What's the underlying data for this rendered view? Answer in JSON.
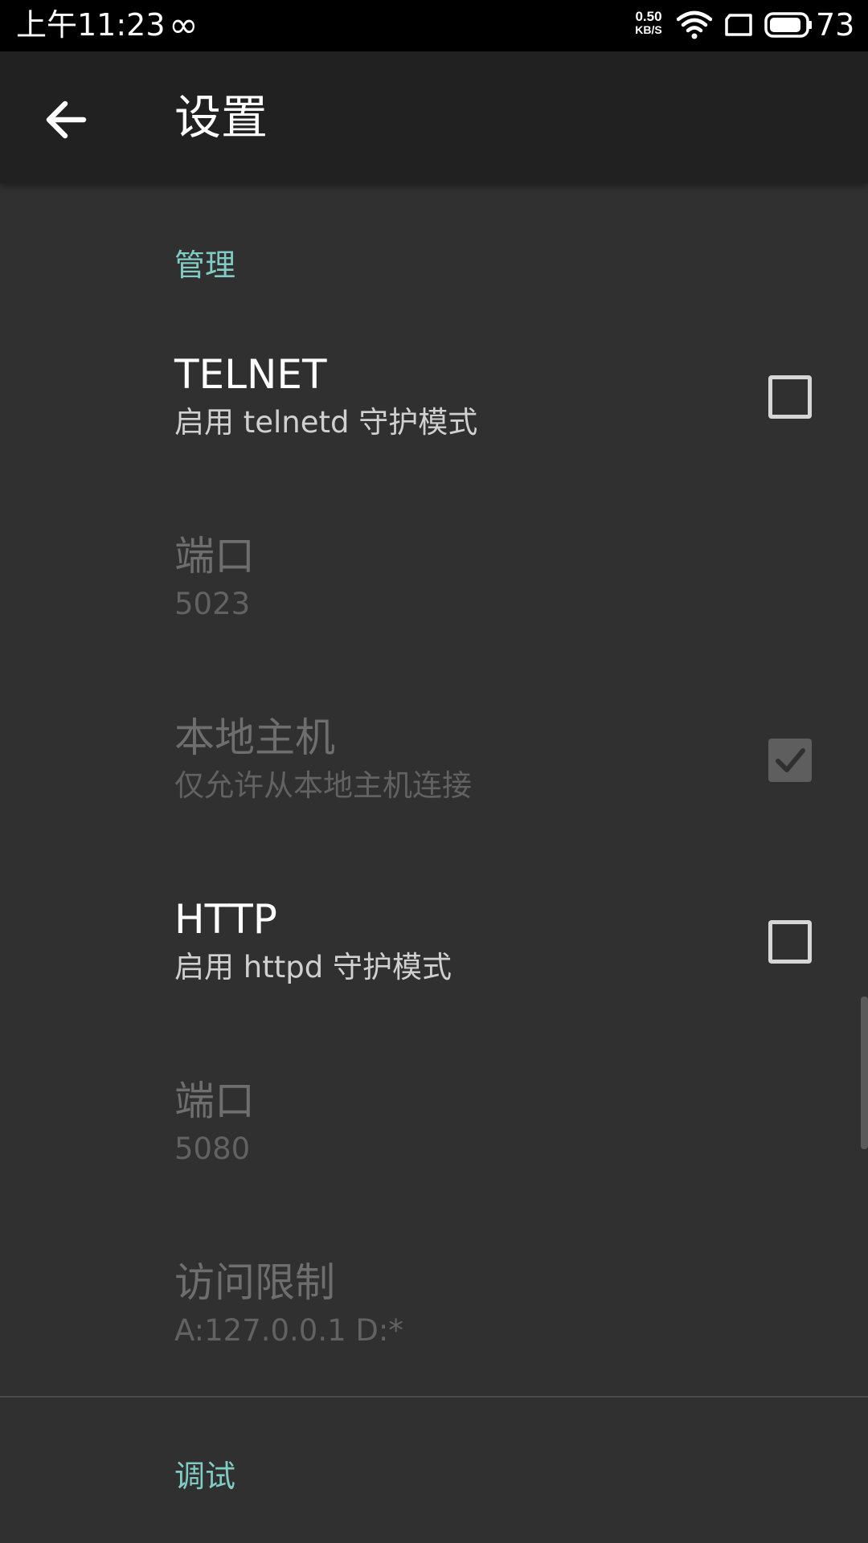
{
  "status_bar": {
    "time": "上午11:23",
    "infinity_icon": "∞",
    "net_speed_value": "0.50",
    "net_speed_unit": "KB/S",
    "battery_level": "73"
  },
  "app_bar": {
    "title": "设置",
    "back_icon": "arrow-back-icon"
  },
  "sections": {
    "management": {
      "header": "管理",
      "telnet": {
        "title": "TELNET",
        "summary": "启用 telnetd 守护模式",
        "checked": false,
        "enabled": true
      },
      "telnet_port": {
        "title": "端口",
        "summary": "5023",
        "enabled": false
      },
      "localhost": {
        "title": "本地主机",
        "summary": "仅允许从本地主机连接",
        "checked": true,
        "enabled": false
      },
      "http": {
        "title": "HTTP",
        "summary": "启用 httpd 守护模式",
        "checked": false,
        "enabled": true
      },
      "http_port": {
        "title": "端口",
        "summary": "5080",
        "enabled": false
      },
      "access_restriction": {
        "title": "访问限制",
        "summary": "A:127.0.0.1 D:*",
        "enabled": false
      }
    },
    "debug": {
      "header": "调试"
    }
  },
  "colors": {
    "background": "#303030",
    "app_bar": "#212121",
    "accent": "#80cbc4",
    "status_bar": "#000000"
  }
}
